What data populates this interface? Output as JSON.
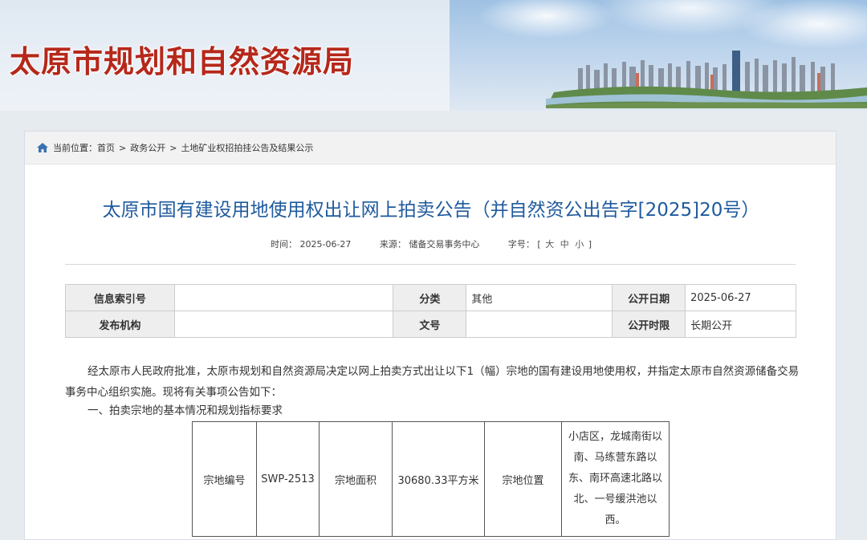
{
  "header": {
    "site_title": "太原市规划和自然资源局"
  },
  "breadcrumb": {
    "label": "当前位置：",
    "items": [
      "首页",
      "政务公开",
      "土地矿业权招拍挂公告及结果公示"
    ],
    "separator": ">"
  },
  "article": {
    "title": "太原市国有建设用地使用权出让网上拍卖公告（并自然资公出告字[2025]20号）",
    "meta": {
      "time_label": "时间：",
      "time_value": "2025-06-27",
      "source_label": "来源：",
      "source_value": "储备交易事务中心",
      "font_label": "字号：",
      "bracket_open": "[",
      "size_large": "大",
      "size_medium": "中",
      "size_small": "小",
      "bracket_close": "]"
    }
  },
  "info_table": {
    "index_label": "信息索引号",
    "index_value": "",
    "category_label": "分类",
    "category_value": "其他",
    "pub_date_label": "公开日期",
    "pub_date_value": "2025-06-27",
    "issuer_label": "发布机构",
    "issuer_value": "",
    "doc_no_label": "文号",
    "doc_no_value": "",
    "period_label": "公开时限",
    "period_value": "长期公开"
  },
  "body": {
    "paragraph1": "经太原市人民政府批准，太原市规划和自然资源局决定以网上拍卖方式出让以下1（幅）宗地的国有建设用地使用权，并指定太原市自然资源储备交易事务中心组织实施。现将有关事项公告如下：",
    "section1_heading": "一、拍卖宗地的基本情况和规划指标要求"
  },
  "parcel_table": {
    "code_label": "宗地编号",
    "code_value": "SWP-2513",
    "area_label": "宗地面积",
    "area_value": "30680.33平方米",
    "location_label": "宗地位置",
    "location_value": "小店区，龙城南街以南、马练营东路以东、南环高速北路以北、一号缓洪池以西。"
  },
  "colors": {
    "site_title": "#b5281b",
    "article_title": "#1f5a9e",
    "label_cell_bg": "#eeeeee"
  }
}
